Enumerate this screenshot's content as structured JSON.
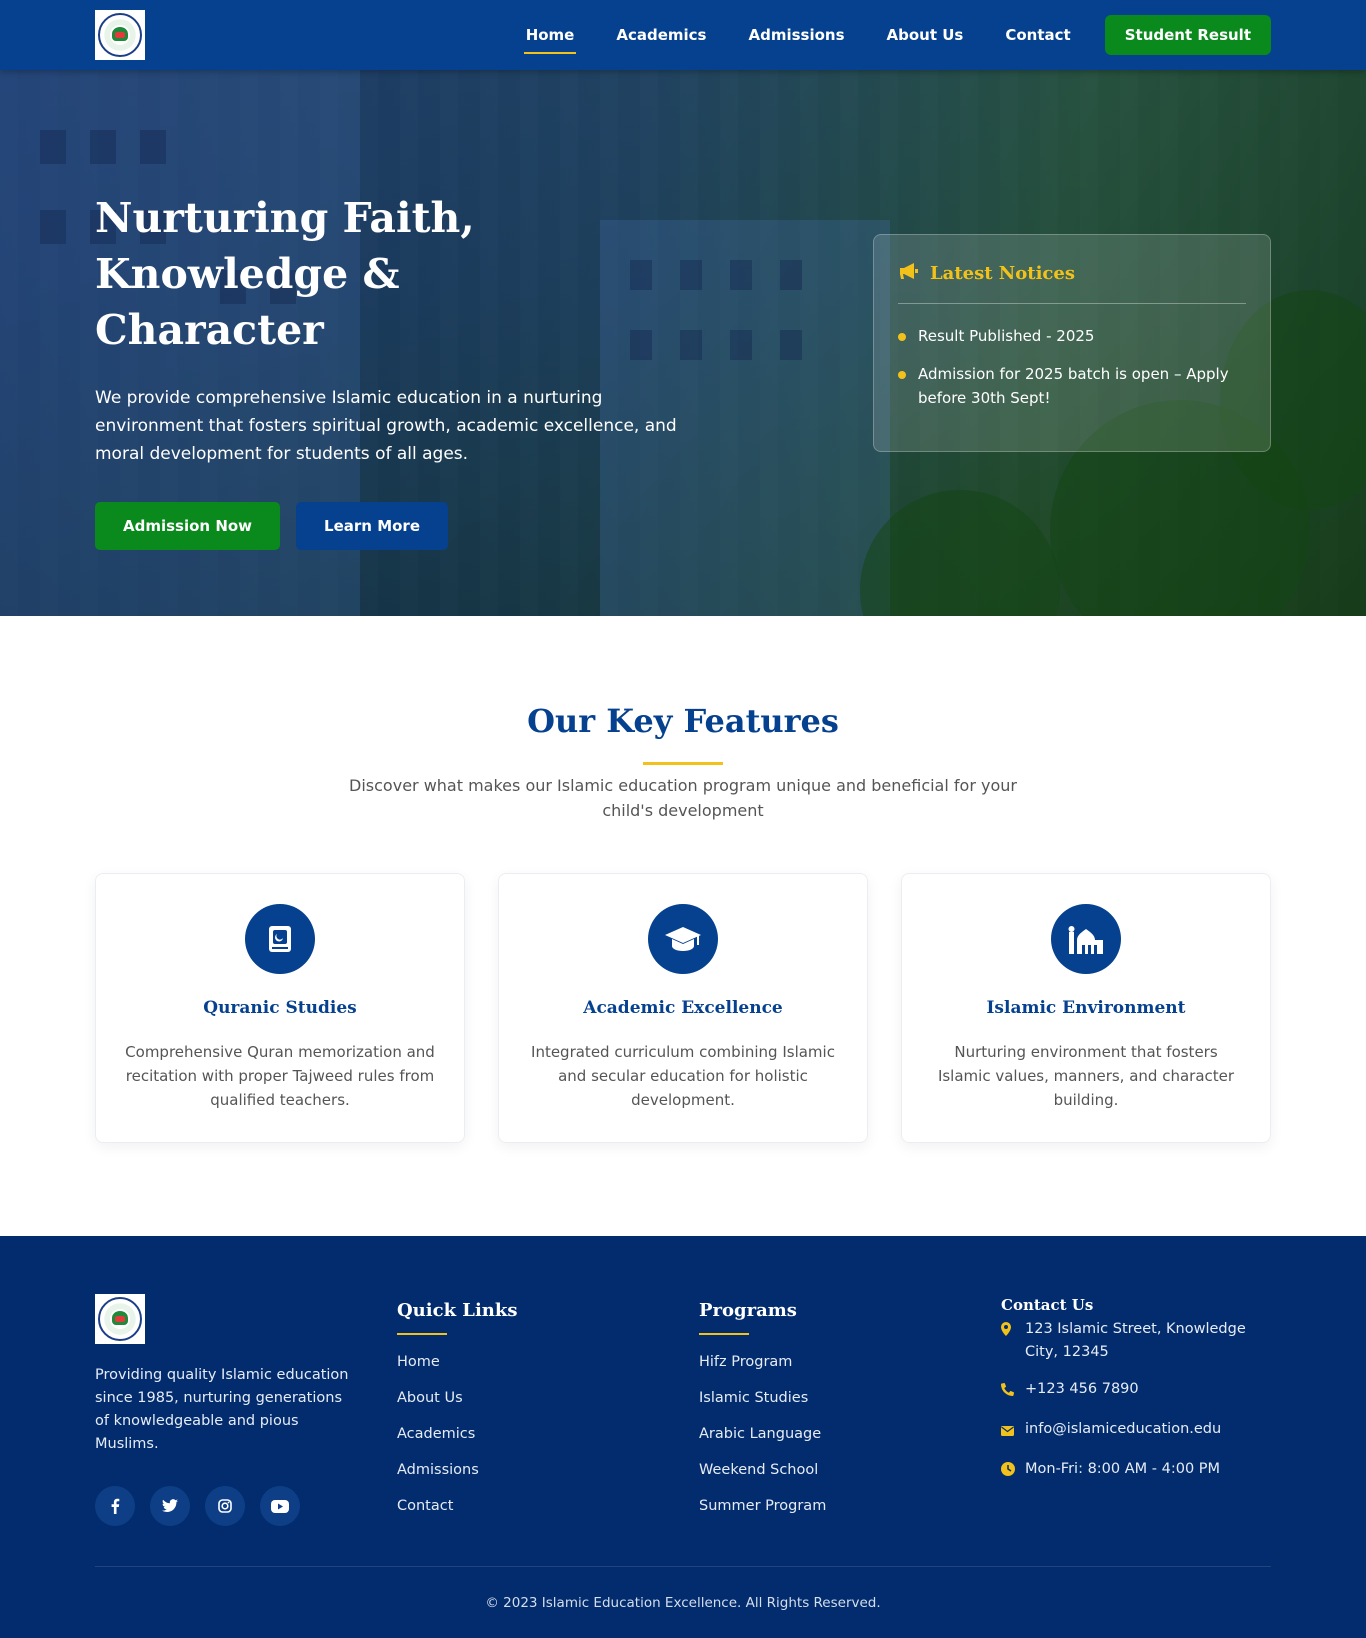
{
  "nav": {
    "logo_alt": "School logo",
    "links": [
      {
        "label": "Home",
        "active": true
      },
      {
        "label": "Academics"
      },
      {
        "label": "Admissions"
      },
      {
        "label": "About Us"
      },
      {
        "label": "Contact"
      }
    ],
    "cta_label": "Student Result"
  },
  "hero": {
    "title_line1": "Nurturing Faith, Knowledge &",
    "title_line2": "Character",
    "description": "We provide comprehensive Islamic education in a nurturing environment that fosters spiritual growth, academic excellence, and moral development for students of all ages.",
    "primary_button": "Admission Now",
    "secondary_button": "Learn More"
  },
  "notices": {
    "icon": "megaphone-icon",
    "title": "Latest Notices",
    "items": [
      "Result Published - 2025",
      "Admission for 2025 batch is open – Apply before 30th Sept!"
    ]
  },
  "features": {
    "title": "Our Key Features",
    "subtitle": "Discover what makes our Islamic education program unique and beneficial for your child's development",
    "cards": [
      {
        "icon": "quran-icon",
        "title": "Quranic Studies",
        "description": "Comprehensive Quran memorization and recitation with proper Tajweed rules from qualified teachers."
      },
      {
        "icon": "graduation-cap-icon",
        "title": "Academic Excellence",
        "description": "Integrated curriculum combining Islamic and secular education for holistic development."
      },
      {
        "icon": "mosque-icon",
        "title": "Islamic Environment",
        "description": "Nurturing environment that fosters Islamic values, manners, and character building."
      }
    ]
  },
  "footer": {
    "about_text": "Providing quality Islamic education since 1985, nurturing generations of knowledgeable and pious Muslims.",
    "socials": [
      "facebook-icon",
      "twitter-icon",
      "instagram-icon",
      "youtube-icon"
    ],
    "quick_links": {
      "title": "Quick Links",
      "items": [
        "Home",
        "About Us",
        "Academics",
        "Admissions",
        "Contact"
      ]
    },
    "programs": {
      "title": "Programs",
      "items": [
        "Hifz Program",
        "Islamic Studies",
        "Arabic Language",
        "Weekend School",
        "Summer Program"
      ]
    },
    "contact": {
      "title": "Contact Us",
      "address": "123 Islamic Street, Knowledge City, 12345",
      "phone": "+123 456 7890",
      "email": "info@islamiceducation.edu",
      "hours": "Mon-Fri: 8:00 AM - 4:00 PM"
    },
    "copyright": "© 2023 Islamic Education Excellence. All Rights Reserved."
  },
  "colors": {
    "primary_blue": "#05418f",
    "footer_blue": "#022c6e",
    "green": "#0a8a1c",
    "accent_yellow": "#f2c21b"
  }
}
